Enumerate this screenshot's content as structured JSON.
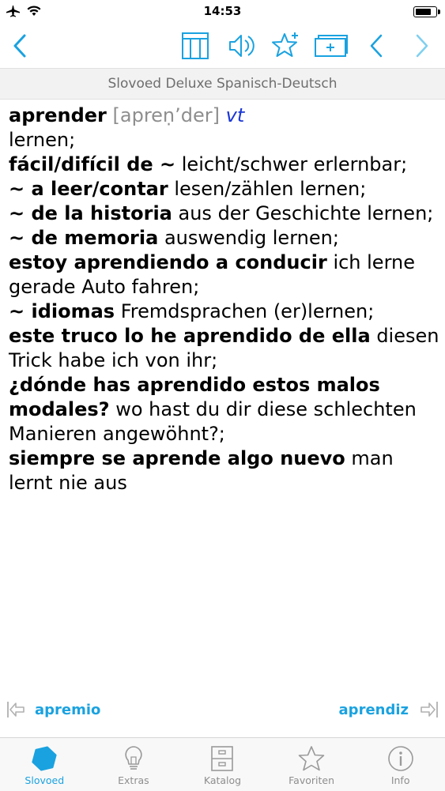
{
  "status": {
    "time": "14:53"
  },
  "header": {
    "title": "Slovoed Deluxe Spanisch-Deutsch"
  },
  "entry": {
    "headword": "aprender",
    "transcription": "[apreṇ’der]",
    "pos": "vt",
    "translation": "lernen;",
    "examples": [
      {
        "es": "fácil/difícil de ~",
        "de": "leicht/schwer erlernbar;"
      },
      {
        "es": "~ a leer/contar",
        "de": "lesen/zählen lernen;"
      },
      {
        "es": "~ de la historia",
        "de": "aus der Geschichte lernen;"
      },
      {
        "es": "~ de memoria",
        "de": "auswendig lernen;"
      },
      {
        "es": "estoy aprendiendo a conducir",
        "de": "ich lerne gerade Auto fahren;"
      },
      {
        "es": "~ idiomas",
        "de": "Fremdsprachen (er)lernen;"
      },
      {
        "es": "este truco lo he aprendido de ella",
        "de": "diesen Trick habe ich von ihr;"
      },
      {
        "es": "¿dónde has aprendido estos malos modales?",
        "de": "wo hast du dir diese schlechten Manieren angewöhnt?;"
      },
      {
        "es": "siempre se aprende algo nuevo",
        "de": "man lernt nie aus"
      }
    ]
  },
  "nav": {
    "prev": "apremio",
    "next": "aprendiz"
  },
  "tabs": [
    {
      "label": "Slovoed",
      "icon": "slovoed-icon",
      "active": true
    },
    {
      "label": "Extras",
      "icon": "lightbulb-icon"
    },
    {
      "label": "Katalog",
      "icon": "cabinet-icon"
    },
    {
      "label": "Favoriten",
      "icon": "star-icon"
    },
    {
      "label": "Info",
      "icon": "info-icon"
    }
  ],
  "colors": {
    "accent": "#1aa2e0",
    "pos": "#1a36d6",
    "transcription": "#8e8e8e"
  },
  "battery_level": 0.85
}
